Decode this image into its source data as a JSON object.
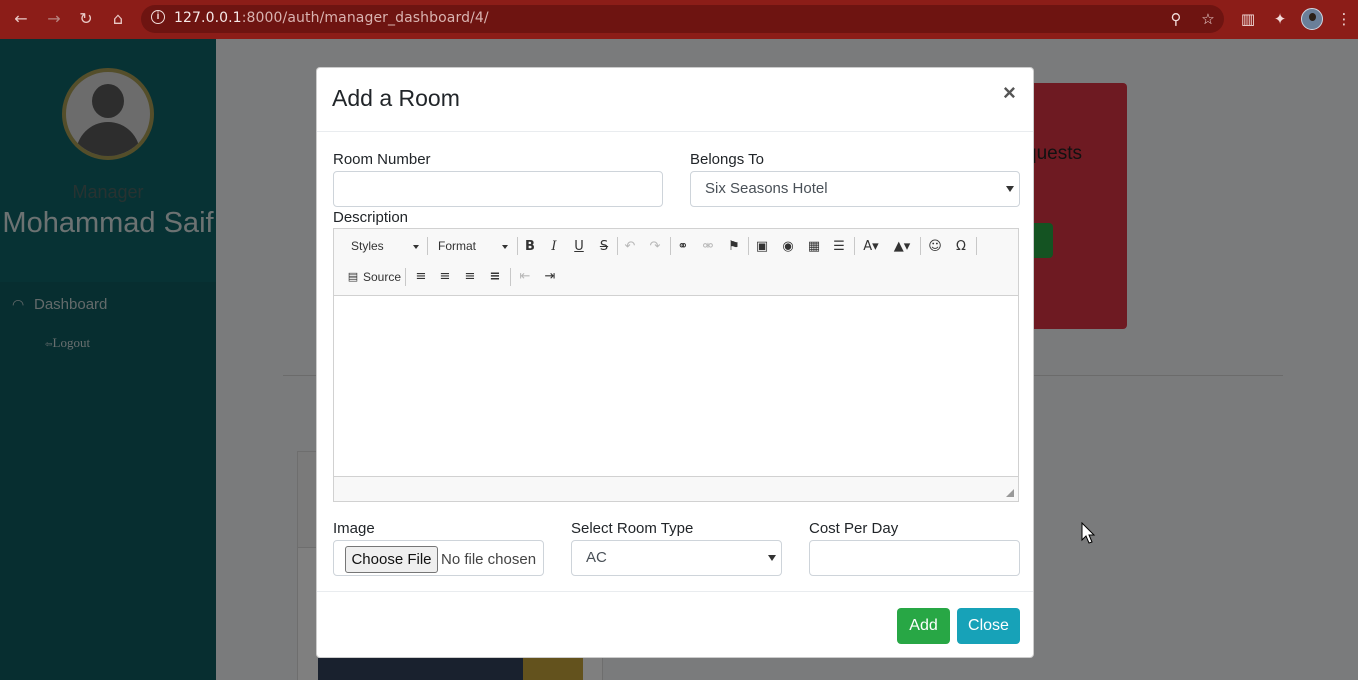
{
  "browser": {
    "url_host": "127.0.0.1",
    "url_rest": ":8000/auth/manager_dashboard/4/",
    "icons": [
      "back-icon",
      "forward-icon",
      "reload-icon",
      "home-icon",
      "info-icon",
      "zoom-icon",
      "star-icon",
      "reading-list-icon",
      "extensions-icon",
      "profile-avatar",
      "menu-icon"
    ]
  },
  "sidebar": {
    "role": "Manager",
    "name": "Mohammad Saif",
    "dashboard_label": "Dashboard",
    "logout_label": "Logout"
  },
  "background": {
    "card_title_fragment": "quests",
    "card_button_fragment": "e"
  },
  "modal": {
    "title": "Add a Room",
    "close_symbol": "×",
    "room_number_label": "Room Number",
    "room_number_value": "",
    "belongs_to_label": "Belongs To",
    "belongs_to_value": "Six Seasons Hotel",
    "description_label": "Description",
    "editor": {
      "styles_label": "Styles",
      "format_label": "Format",
      "source_label": "Source",
      "bold": "B",
      "italic": "I",
      "underline": "U",
      "strike": "S",
      "omega": "Ω"
    },
    "image_label": "Image",
    "choose_file_label": "Choose File",
    "no_file_text": "No file chosen",
    "room_type_label": "Select Room Type",
    "room_type_value": "AC",
    "cost_label": "Cost Per Day",
    "cost_value": "",
    "add_button": "Add",
    "close_button": "Close"
  },
  "colors": {
    "chrome": "#8c1d18",
    "sidebar": "#0e5c61",
    "add_button": "#28a745",
    "close_button": "#17a2b8"
  }
}
